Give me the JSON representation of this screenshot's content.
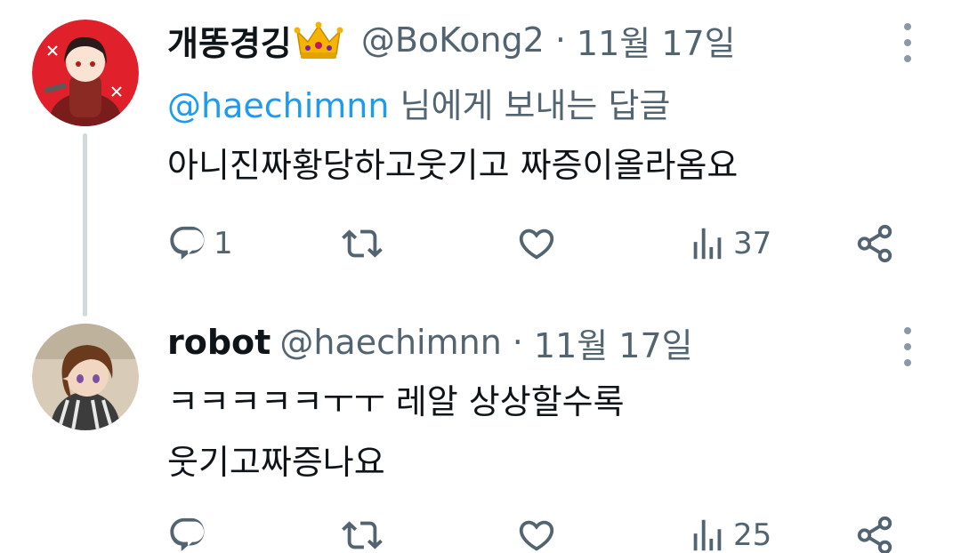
{
  "tweets": [
    {
      "display_name": "개똥경깅",
      "name_emoji": "crown",
      "handle": "@BoKong2",
      "separator": "·",
      "date": "11월 17일",
      "reply_to": {
        "mention": "@haechimnn",
        "suffix": " 님에게 보내는 답글"
      },
      "lines": [
        "아니진짜황당하고웃기고 짜증이올라옴요"
      ],
      "actions": {
        "reply_count": "1",
        "retweet_count": "",
        "like_count": "",
        "views_count": "37"
      },
      "avatar_colors": {
        "background": "#e0202b"
      }
    },
    {
      "display_name": "robot",
      "handle": "@haechimnn",
      "separator": "·",
      "date": "11월 17일",
      "lines": [
        "ㅋㅋㅋㅋㅋㅜㅜ 레알 상상할수록",
        "웃기고짜증나요"
      ],
      "actions": {
        "reply_count": "",
        "retweet_count": "",
        "like_count": "",
        "views_count": "25"
      },
      "avatar_colors": {
        "background": "#d8cbb8"
      }
    }
  ],
  "icons": {
    "reply": "reply-icon",
    "retweet": "retweet-icon",
    "like": "heart-icon",
    "views": "views-icon",
    "share": "share-icon",
    "more": "more-options-icon"
  },
  "colors": {
    "text": "#0f1419",
    "secondary": "#536471",
    "link": "#1d9bf0",
    "thread_line": "#cfd9de"
  }
}
